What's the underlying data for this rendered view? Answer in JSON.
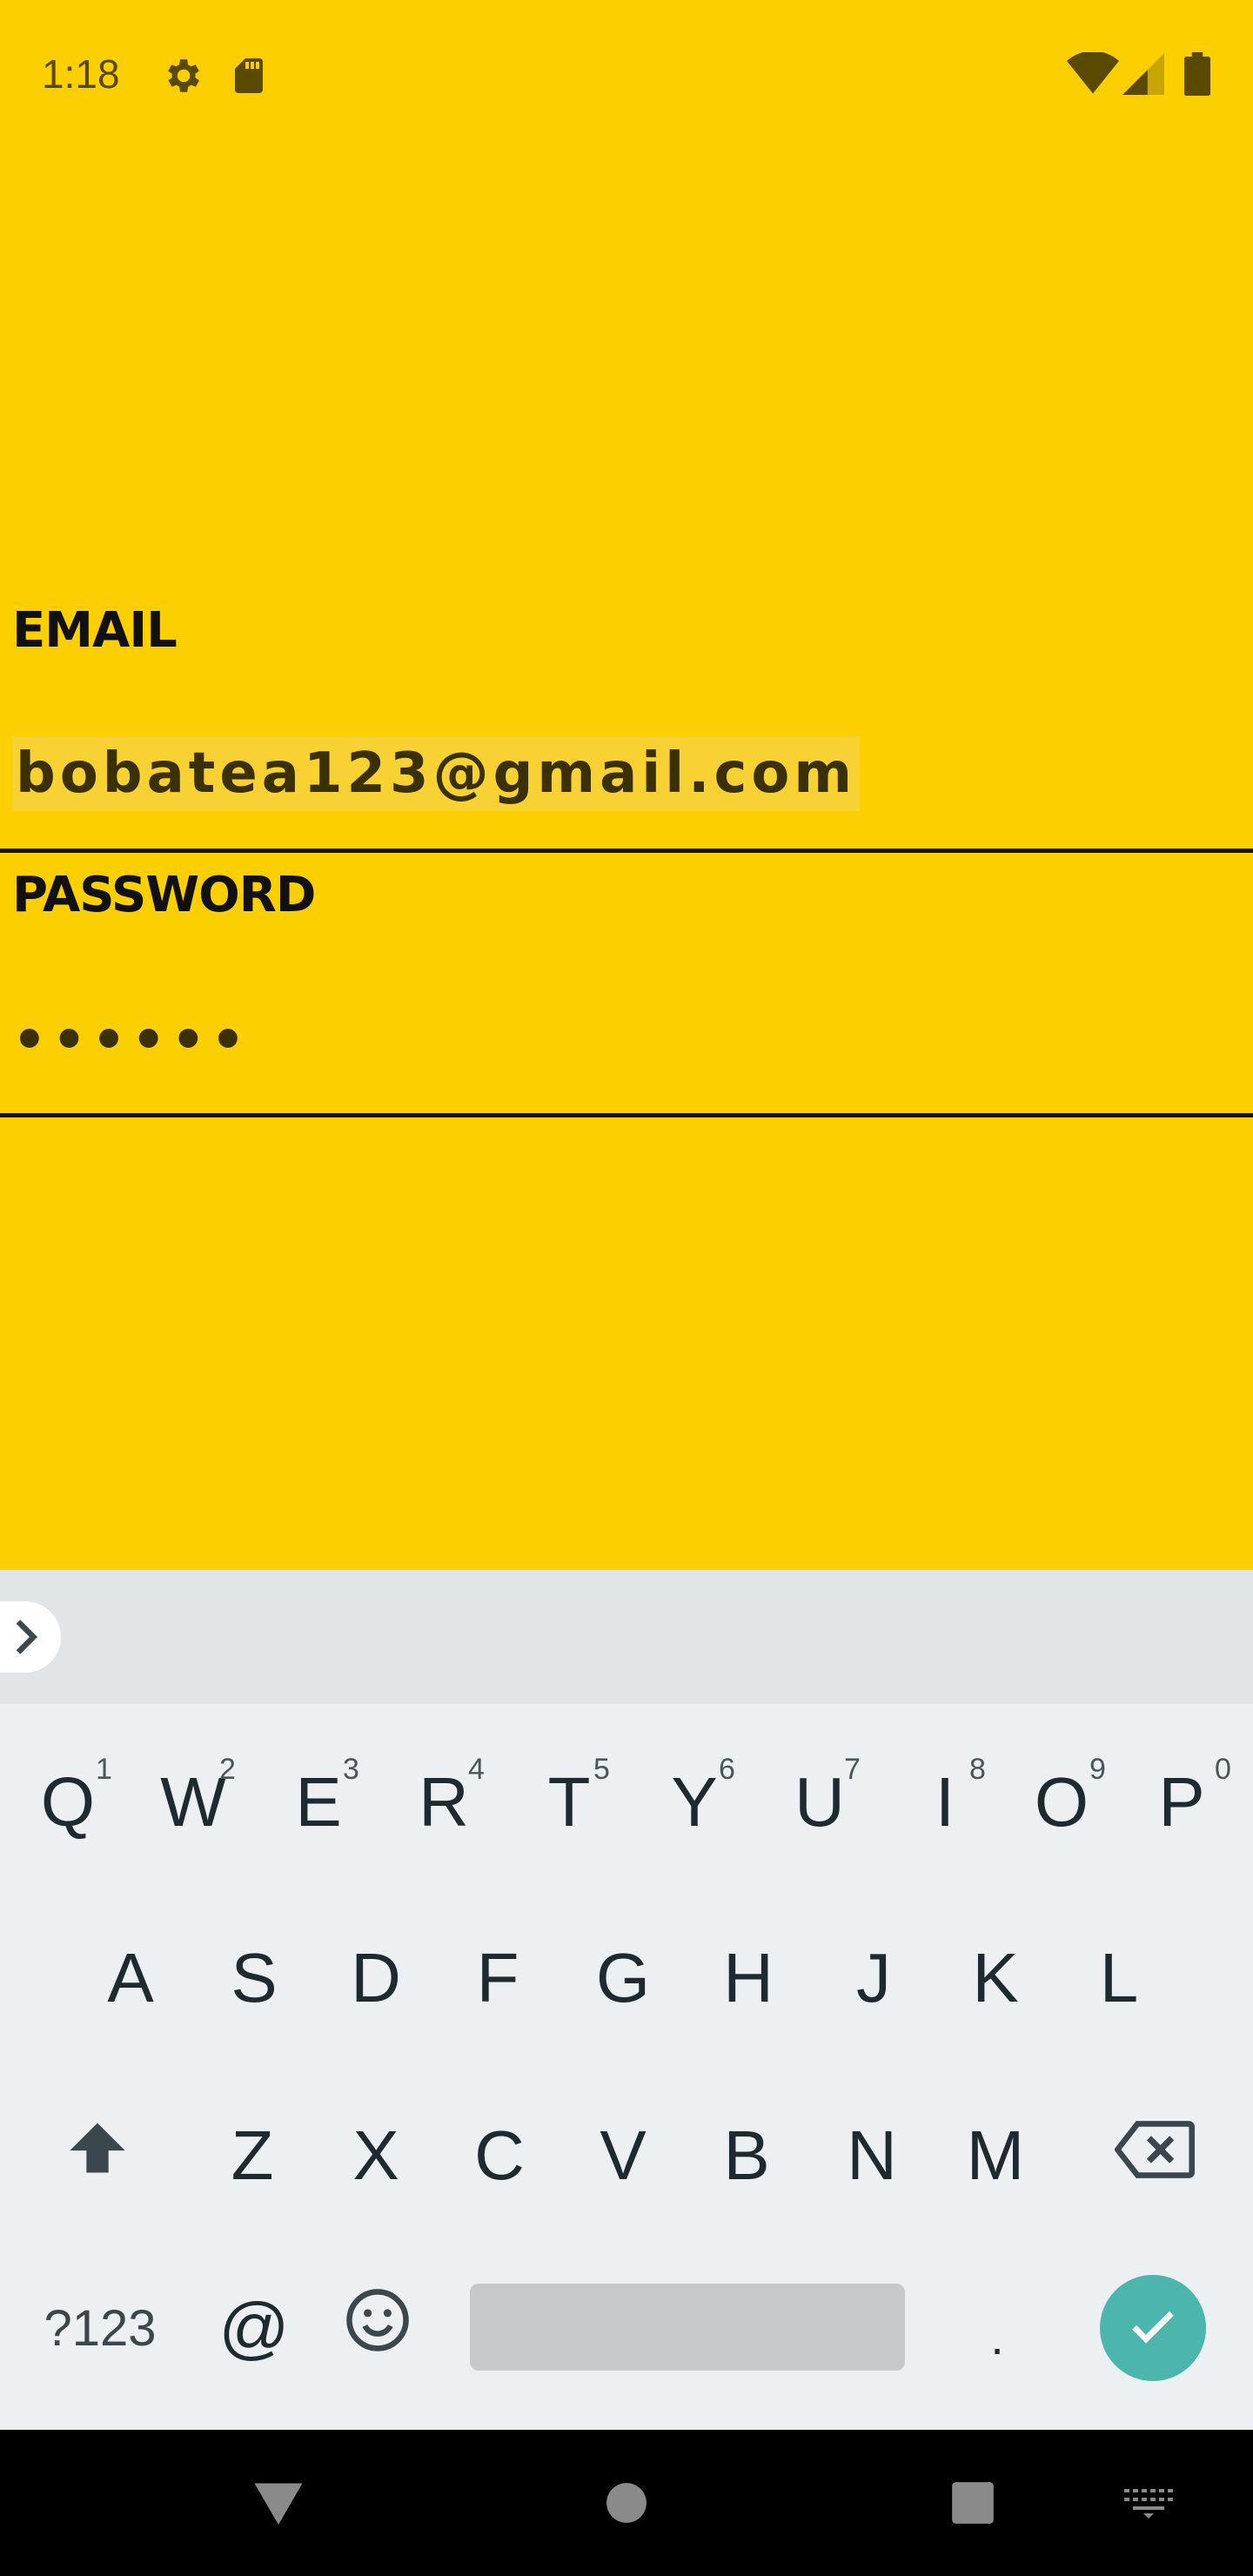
{
  "status_bar": {
    "time": "1:18",
    "left_icons": [
      "gear-icon",
      "sd-card-icon"
    ],
    "right_icons": [
      "wifi-icon",
      "cell-signal-icon",
      "battery-icon"
    ]
  },
  "colors": {
    "background": "#FCCF00",
    "text": "#111111",
    "keyboard_bg": "#EDF0F3",
    "enter_key": "#4DB6AC"
  },
  "form": {
    "email": {
      "label": "EMAIL",
      "value": "bobatea123@gmail.com"
    },
    "password": {
      "label": "PASSWORD",
      "value": "••••••"
    }
  },
  "keyboard": {
    "row1": [
      {
        "key": "Q",
        "hint": "1"
      },
      {
        "key": "W",
        "hint": "2"
      },
      {
        "key": "E",
        "hint": "3"
      },
      {
        "key": "R",
        "hint": "4"
      },
      {
        "key": "T",
        "hint": "5"
      },
      {
        "key": "Y",
        "hint": "6"
      },
      {
        "key": "U",
        "hint": "7"
      },
      {
        "key": "I",
        "hint": "8"
      },
      {
        "key": "O",
        "hint": "9"
      },
      {
        "key": "P",
        "hint": "0"
      }
    ],
    "row2": [
      "A",
      "S",
      "D",
      "F",
      "G",
      "H",
      "J",
      "K",
      "L"
    ],
    "row3": [
      "Z",
      "X",
      "C",
      "V",
      "B",
      "N",
      "M"
    ],
    "symbols_key": "?123",
    "at_key": "@",
    "period_key": "."
  },
  "nav_bar": {
    "icons": [
      "back-icon",
      "home-icon",
      "recents-icon",
      "keyboard-switch-icon"
    ]
  }
}
